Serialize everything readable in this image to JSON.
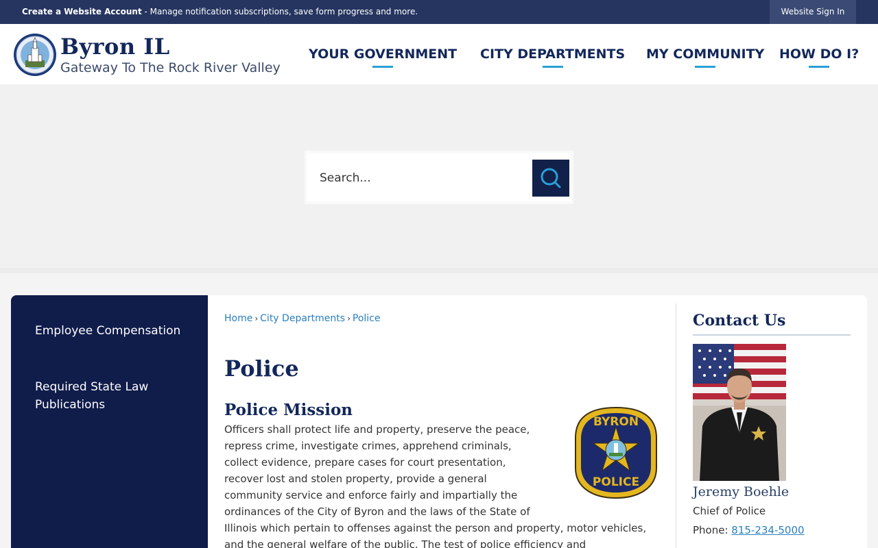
{
  "topbar": {
    "account_link": "Create a Website Account",
    "account_desc": " - Manage notification subscriptions, save form progress and more.",
    "signin": "Website Sign In"
  },
  "header": {
    "site_name": "Byron IL",
    "tagline": "Gateway To The Rock River Valley",
    "seal_text": "CITY OF BYRON · FOUNDED IN 1835",
    "nav": [
      {
        "label": "YOUR GOVERNMENT"
      },
      {
        "label": "CITY DEPARTMENTS"
      },
      {
        "label": "MY COMMUNITY"
      },
      {
        "label": "HOW DO I?"
      }
    ]
  },
  "search": {
    "placeholder": "Search..."
  },
  "sidebar": {
    "items": [
      {
        "label": "Employee Compensation"
      },
      {
        "label": "Required State Law Publications"
      }
    ]
  },
  "breadcrumb": {
    "items": [
      "Home",
      "City Departments",
      "Police"
    ]
  },
  "main": {
    "title": "Police",
    "mission_title": "Police Mission",
    "mission_text": "Officers shall protect life and property, preserve the peace, repress crime, investigate crimes, apprehend criminals, collect evidence, prepare cases for court presentation, recover lost and stolen property, provide a general community service and enforce fairly and impartially the ordinances of the City of Byron and the laws of the State of Illinois which pertain to offenses against the person and property, motor vehicles, and the general welfare of the public. The test of police efficiency and",
    "badge_top": "BYRON",
    "badge_bottom": "POLICE"
  },
  "contact": {
    "title": "Contact Us",
    "name": "Jeremy Boehle",
    "role": "Chief of Police",
    "phone_label": "Phone: ",
    "phone": "815-234-5000"
  },
  "colors": {
    "navy": "#12275a",
    "topbar": "#263560",
    "sidebar": "#101c4a",
    "accent": "#2a9fd6",
    "link": "#2a7fc0"
  }
}
